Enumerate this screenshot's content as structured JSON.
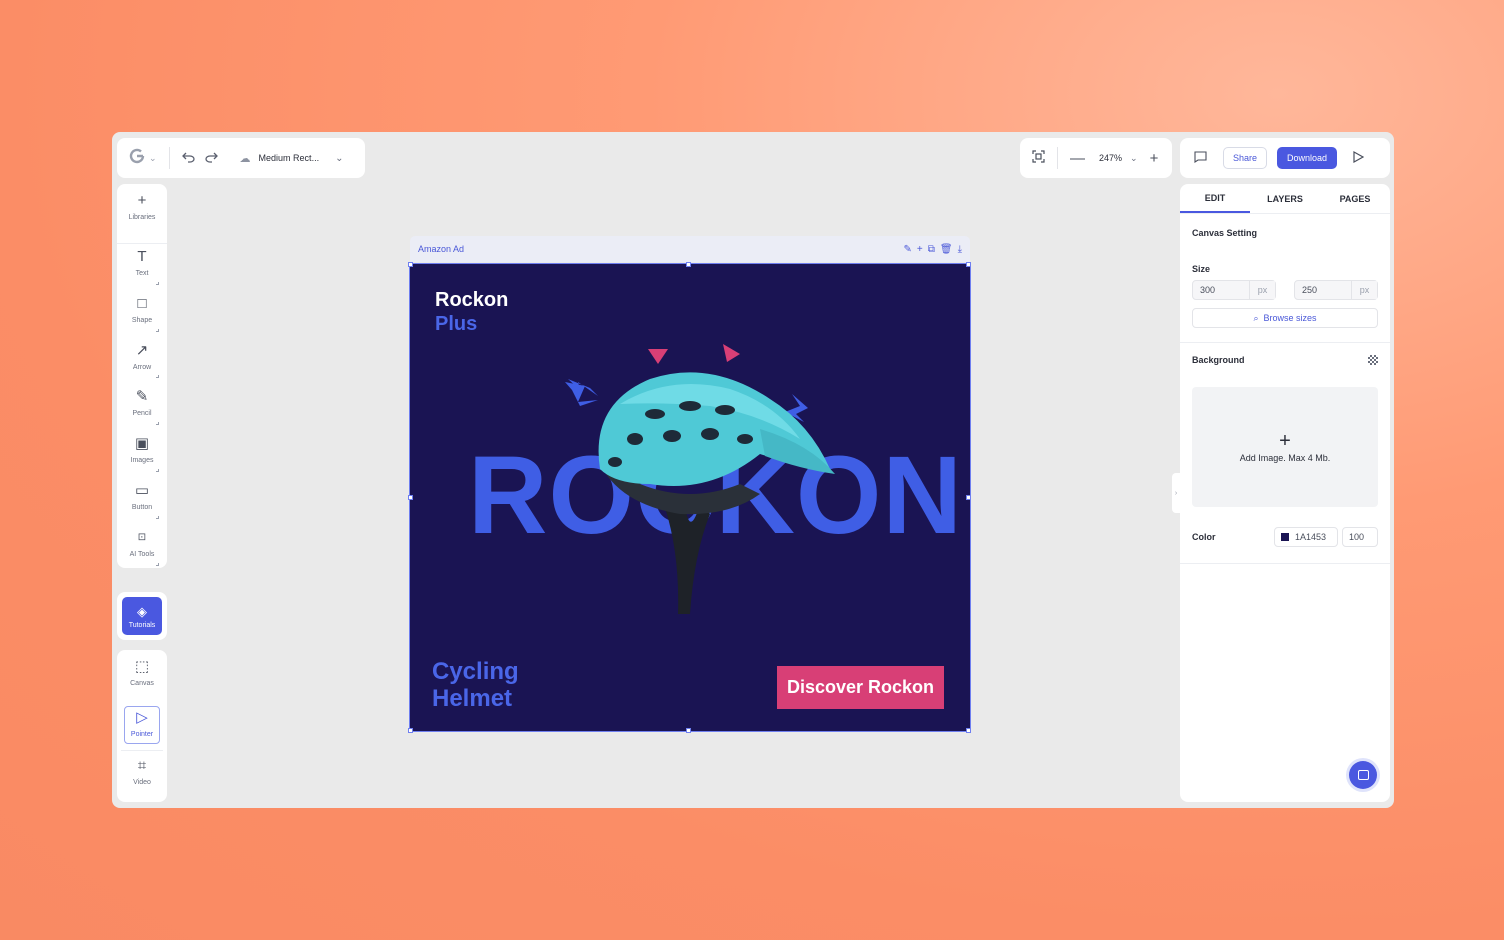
{
  "header": {
    "undo_icon": "undo-icon",
    "redo_icon": "redo-icon",
    "document_name": "Medium Rect...",
    "zoom": "247%",
    "share_label": "Share",
    "download_label": "Download"
  },
  "tools": [
    {
      "label": "Libraries",
      "icon": "plus-icon"
    },
    {
      "label": "Text",
      "icon": "text-icon"
    },
    {
      "label": "Shape",
      "icon": "square-icon"
    },
    {
      "label": "Arrow",
      "icon": "arrow-icon"
    },
    {
      "label": "Pencil",
      "icon": "pencil-icon"
    },
    {
      "label": "Images",
      "icon": "image-icon"
    },
    {
      "label": "Button",
      "icon": "button-icon"
    },
    {
      "label": "AI Tools",
      "icon": "ai-icon"
    }
  ],
  "tutorials_label": "Tutorials",
  "bottom_tools": [
    {
      "label": "Canvas",
      "icon": "canvas-icon"
    },
    {
      "label": "Pointer",
      "icon": "pointer-icon"
    },
    {
      "label": "Video",
      "icon": "video-icon"
    }
  ],
  "frame": {
    "name": "Amazon Ad"
  },
  "ad": {
    "title_line1": "Rockon",
    "title_line2": "Plus",
    "big_text": "ROCKON",
    "subtitle_line1": "Cycling",
    "subtitle_line2": "Helmet",
    "cta": "Discover Rockon",
    "background": "#1A1453",
    "accent_blue": "#3F5EE5",
    "cta_color": "#D83F76"
  },
  "panel": {
    "tabs": [
      "EDIT",
      "LAYERS",
      "PAGES"
    ],
    "active_tab": "EDIT",
    "canvas_setting_label": "Canvas Setting",
    "size_label": "Size",
    "width": "300",
    "height": "250",
    "unit": "px",
    "browse_sizes": "Browse sizes",
    "background_label": "Background",
    "add_image": "Add Image. Max 4 Mb.",
    "color_label": "Color",
    "color_hex": "1A1453",
    "opacity": "100"
  }
}
